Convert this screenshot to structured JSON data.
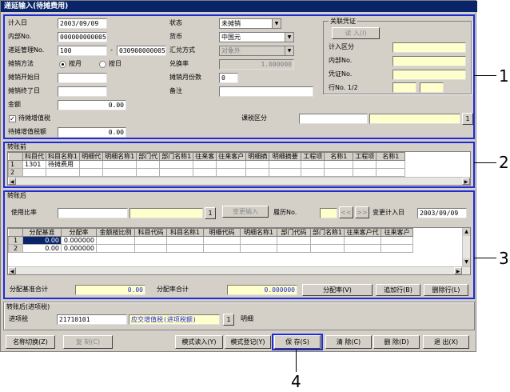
{
  "window": {
    "title": "递延输入(待摊费用)"
  },
  "section1": {
    "labels": {
      "entry_date": "计入日",
      "internal_no": "内部No.",
      "deferral_mgmt_no": "递延管理No.",
      "amort_method": "摊销方法",
      "amort_start": "摊销开始日",
      "amort_end": "摊销终了日",
      "amount": "金额",
      "pending_vat_check": "待摊增值税",
      "pending_vat_amount": "待摊增值税额",
      "status": "状态",
      "currency": "货币",
      "summary_method": "汇兑方式",
      "exchange_rate": "兑换率",
      "monthly_periods": "摊销月份数",
      "remarks": "备注",
      "tax_category": "课税区分"
    },
    "values": {
      "entry_date": "2003/09/09",
      "internal_no": "000000000005",
      "mgmt_no_prefix": "100",
      "mgmt_no_dash": "-",
      "mgmt_no_suffix": "030900000005",
      "amount": "0.00",
      "pending_vat_amount": "0.00",
      "status": "未摊销",
      "currency": "中国元",
      "summary_method": "对象外",
      "exchange_rate": "1.000000",
      "monthly_periods": "0",
      "checkmark": "✓"
    },
    "radio": {
      "by_month": "按月",
      "by_day": "按日"
    },
    "tax_button": "1",
    "related_voucher": {
      "title": "关联凭证",
      "import_button": "读 入(I)",
      "labels": {
        "entry_category": "计入区分",
        "internal_no": "内部No.",
        "voucher_no": "凭证No.",
        "row_no": "行No. 1/2"
      }
    }
  },
  "section2": {
    "title": "转账前",
    "columns": [
      "",
      "科目代",
      "科目名称1",
      "明细代",
      "明细名称1",
      "部门代",
      "部门名称1",
      "往来客",
      "往来客户",
      "明细摘",
      "明细摘要",
      "工程项",
      "名称1",
      "工程项",
      "名称1"
    ],
    "rows": [
      [
        "1",
        "1301",
        "待摊费用",
        "",
        "",
        "",
        "",
        "",
        "",
        "",
        "",
        "",
        "",
        "",
        ""
      ],
      [
        "2",
        "",
        "",
        "",
        "",
        "",
        "",
        "",
        "",
        "",
        "",
        "",
        "",
        "",
        ""
      ]
    ]
  },
  "section3": {
    "title": "转账后",
    "usage_ratio_label": "使用比率",
    "ratio_button": "1",
    "change_input_button": "变更输入",
    "history_label": "履历No.",
    "prev_arrow": "<<",
    "next_arrow": ">>",
    "change_date_label": "变更计入日",
    "change_date_value": "2003/09/09",
    "columns": [
      "",
      "分配基准",
      "分配率",
      "金额按比例",
      "科目代码",
      "科目名称1",
      "明细代码",
      "明细名称1",
      "部门代码",
      "部门名称1",
      "往来客户代",
      "往来客户"
    ],
    "rows": [
      [
        "1",
        "0.00",
        "0.000000",
        "",
        "",
        "",
        "",
        "",
        "",
        "",
        "",
        ""
      ],
      [
        "2",
        "0.00",
        "0.000000",
        "",
        "",
        "",
        "",
        "",
        "",
        "",
        "",
        ""
      ]
    ],
    "base_total_label": "分配基准合计",
    "base_total_value": "0.00",
    "rate_total_label": "分配率合计",
    "rate_total_value": "0.000000",
    "alloc_button": "分配率(V)",
    "add_row_button": "追加行(B)",
    "delete_row_button": "删除行(L)"
  },
  "section4": {
    "title": "转账后(进项税)",
    "label": "进项税",
    "code": "21710101",
    "name": "应交增值税(进项税额)",
    "btn": "1",
    "detail_label": "明细"
  },
  "footer": {
    "name_switch": "名称切换(Z)",
    "copy": "复 制(C)",
    "template_load": "模式读入(Y)",
    "template_register": "模式登记(Y)",
    "save": "保 存(S)",
    "clear": "清 除(C)",
    "delete": "删 除(D)",
    "exit": "退 出(X)"
  },
  "callouts": [
    "1",
    "2",
    "3",
    "4"
  ]
}
